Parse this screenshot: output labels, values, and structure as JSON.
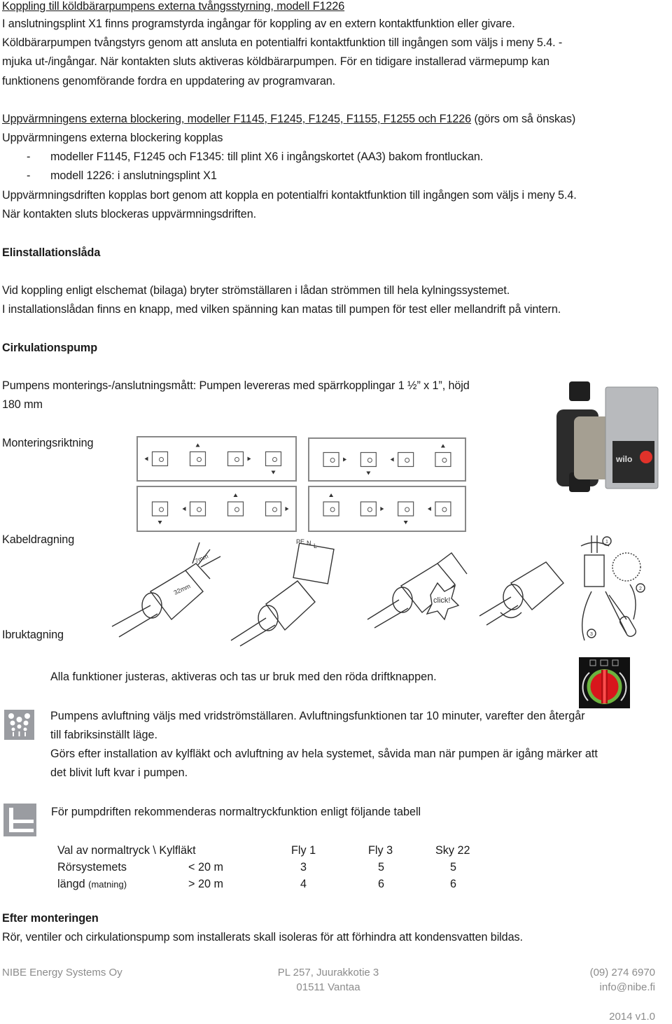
{
  "section1": {
    "heading": "Koppling till köldbärarpumpens externa tvångsstyrning, modell F1226",
    "lines": [
      "I anslutningsplint X1 finns programstyrda ingångar för koppling av en extern kontaktfunktion eller givare.",
      "Köldbärarpumpen tvångstyrs genom att ansluta en potentialfri kontaktfunktion till ingången som väljs i meny 5.4. -",
      "mjuka ut-/ingångar. När kontakten sluts aktiveras köldbärarpumpen. För en tidigare installerad värmepump kan",
      "funktionens genomförande fordra en uppdatering av programvaran."
    ]
  },
  "section2": {
    "heading": "Uppvärmningens externa blockering, modeller F1145, F1245, F1245, F1155, F1255 och F1226",
    "heading_suffix": " (görs om så önskas)",
    "intro": "Uppvärmningens externa blockering kopplas",
    "bullets": [
      "modeller F1145, F1245 och F1345: till plint X6 i ingångskortet (AA3) bakom frontluckan.",
      "modell 1226: i anslutningsplint X1"
    ],
    "bullet_marker": "-",
    "lines": [
      "Uppvärmningsdriften kopplas bort genom att koppla en potentialfri kontaktfunktion till ingången som väljs i meny 5.4.",
      "När kontakten sluts blockeras uppvärmningsdriften."
    ]
  },
  "section3": {
    "heading": "Elinstallationslåda",
    "lines": [
      "Vid koppling enligt elschemat (bilaga) bryter strömställaren i lådan strömmen till hela kylningssystemet.",
      "I installationslådan finns en knapp, med vilken spänning kan matas till pumpen för test eller mellandrift på vintern."
    ]
  },
  "section4": {
    "heading": "Cirkulationspump",
    "dimensions_line1": "Pumpens monterings-/anslutningsmått: Pumpen levereras med spärrkopplingar 1 ½” x 1”, höjd",
    "dimensions_line2": "180 mm",
    "mounting_label": "Monteringsriktning",
    "cabling_label": "Kabeldragning",
    "commissioning_label": "Ibruktagning",
    "pump_brand": "wilo",
    "wire_labels": [
      "PE",
      "N",
      "L"
    ],
    "strip_lengths": [
      "7mm",
      "32mm"
    ],
    "click_label": "click!",
    "step_numbers": [
      "1",
      "2",
      "3"
    ],
    "operation_line": "Alla funktioner justeras, aktiveras och tas ur bruk med den röda driftknappen.",
    "venting_lines": [
      "Pumpens avluftning väljs med vridströmställaren. Avluftningsfunktionen tar 10 minuter, varefter den återgår",
      "till fabriksinställt läge.",
      "Görs efter installation av kylfläkt och avluftning av hela systemet, såvida man när pumpen är igång märker att",
      "det blivit luft kvar i pumpen."
    ],
    "pressure_line": "För pumpdriften rekommenderas normaltryckfunktion enligt följande tabell"
  },
  "table": {
    "header": [
      "Val av normaltryck \\ Kylfläkt",
      "Fly 1",
      "Fly 3",
      "Sky 22"
    ],
    "rows": [
      {
        "label": "Rörsystemets",
        "label_small": "",
        "range": "< 20 m",
        "values": [
          "3",
          "5",
          "5"
        ]
      },
      {
        "label": "längd",
        "label_small": "(matning)",
        "range": "> 20 m",
        "values": [
          "4",
          "6",
          "6"
        ]
      }
    ]
  },
  "section5": {
    "heading": "Efter monteringen",
    "line": "Rör, ventiler och cirkulationspump som installerats skall isoleras för att förhindra att kondensvatten bildas."
  },
  "footer": {
    "company": "NIBE Energy Systems Oy",
    "address_line1": "PL 257, Juurakkotie 3",
    "address_line2": "01511 Vantaa",
    "phone": "(09) 274 6970",
    "email": "info@nibe.fi",
    "version": "2014 v1.0"
  },
  "colors": {
    "text": "#1a1a1a",
    "footer_text": "#8c8c8c",
    "icon_gray": "#9a9ca1",
    "knob_red": "#d8161c",
    "knob_green": "#6cb33f"
  }
}
